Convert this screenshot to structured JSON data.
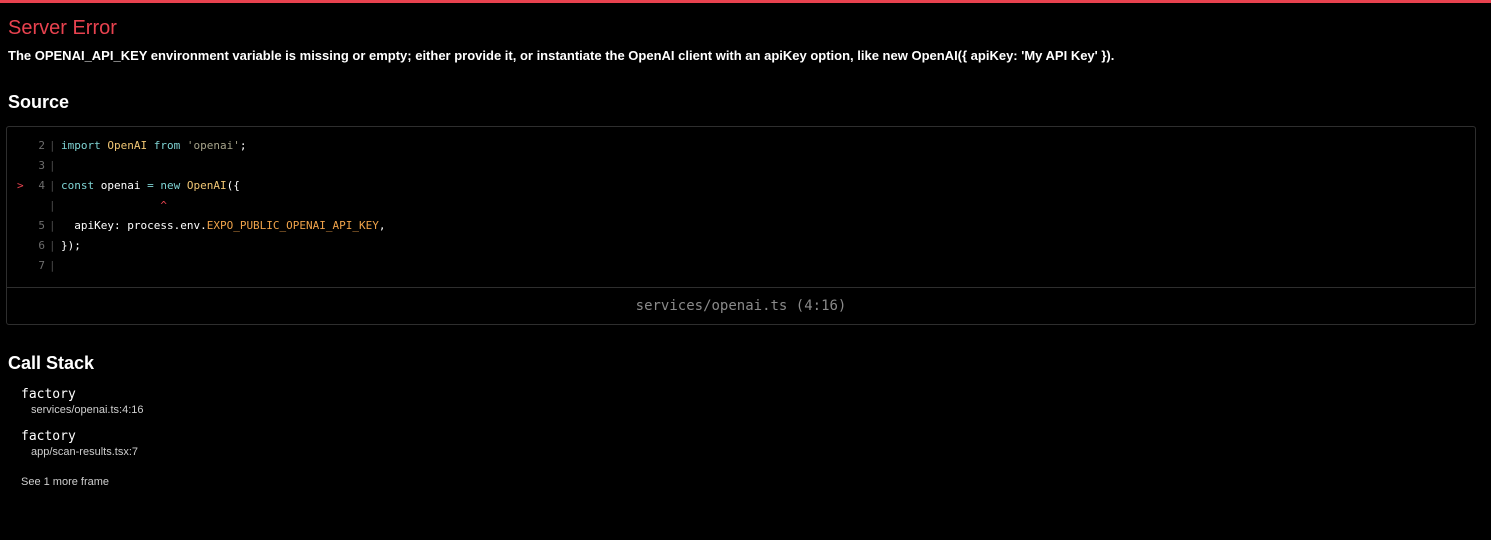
{
  "colors": {
    "accent": "#e8424f",
    "background": "#000000",
    "text": "#ffffff",
    "muted": "#8a8a8a",
    "keyword": "#7fd4d4",
    "class_name": "#f0c674",
    "string": "#a6a38a",
    "env_var": "#f0a34a"
  },
  "error": {
    "title": "Server Error",
    "message": "The OPENAI_API_KEY environment variable is missing or empty; either provide it, or instantiate the OpenAI client with an apiKey option, like new OpenAI({ apiKey: 'My API Key' })."
  },
  "source": {
    "heading": "Source",
    "gutter_char": "|",
    "marker": ">",
    "lines": [
      {
        "number": "2",
        "tokens": [
          {
            "t": "import",
            "c": "kw"
          },
          {
            "t": " ",
            "c": ""
          },
          {
            "t": "OpenAI",
            "c": "cls"
          },
          {
            "t": " ",
            "c": ""
          },
          {
            "t": "from",
            "c": "kw"
          },
          {
            "t": " ",
            "c": ""
          },
          {
            "t": "'openai'",
            "c": "str"
          },
          {
            "t": ";",
            "c": ""
          }
        ]
      },
      {
        "number": "3",
        "tokens": []
      },
      {
        "number": "4",
        "highlight": true,
        "tokens": [
          {
            "t": "const",
            "c": "kw"
          },
          {
            "t": " openai ",
            "c": ""
          },
          {
            "t": "=",
            "c": "kw"
          },
          {
            "t": " ",
            "c": ""
          },
          {
            "t": "new",
            "c": "kw"
          },
          {
            "t": " ",
            "c": ""
          },
          {
            "t": "OpenAI",
            "c": "cls"
          },
          {
            "t": "({",
            "c": ""
          }
        ]
      },
      {
        "number": "",
        "tokens": [
          {
            "t": "               ^",
            "c": "caret"
          }
        ]
      },
      {
        "number": "5",
        "tokens": [
          {
            "t": "  apiKey: process.env.",
            "c": ""
          },
          {
            "t": "EXPO_PUBLIC_OPENAI_API_KEY",
            "c": "env"
          },
          {
            "t": ",",
            "c": ""
          }
        ]
      },
      {
        "number": "6",
        "tokens": [
          {
            "t": "});",
            "c": ""
          }
        ]
      },
      {
        "number": "7",
        "tokens": []
      }
    ],
    "location": "services/openai.ts (4:16)"
  },
  "call_stack": {
    "heading": "Call Stack",
    "frames": [
      {
        "function": "factory",
        "file": "services/openai.ts:4:16"
      },
      {
        "function": "factory",
        "file": "app/scan-results.tsx:7"
      }
    ],
    "more_label": "See 1 more frame"
  }
}
